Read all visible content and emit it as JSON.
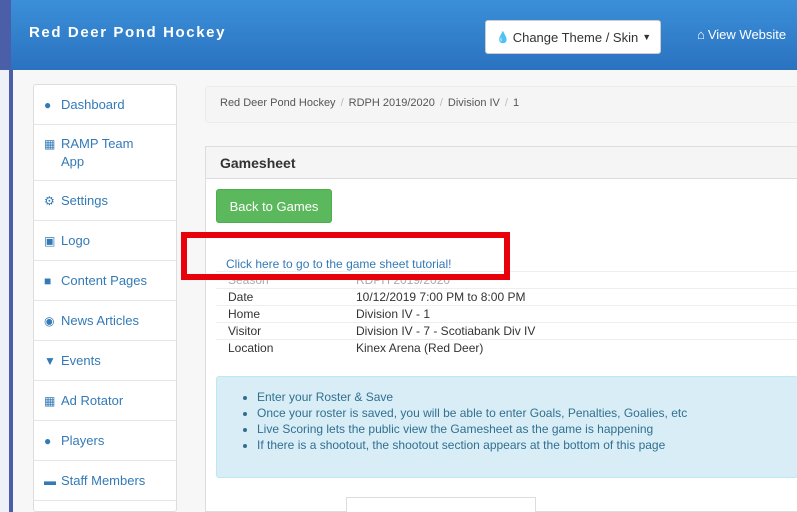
{
  "navbar": {
    "brand": "Red Deer Pond Hockey",
    "theme_button": "Change Theme / Skin",
    "view_website": "View Website"
  },
  "sidebar": {
    "items": [
      {
        "label": "Dashboard",
        "icon": "user-icon"
      },
      {
        "label": "RAMP Team\nApp",
        "icon": "grid-icon"
      },
      {
        "label": "Settings",
        "icon": "gear-icon"
      },
      {
        "label": "Logo",
        "icon": "camera-icon"
      },
      {
        "label": "Content Pages",
        "icon": "file-icon"
      },
      {
        "label": "News Articles",
        "icon": "globe-icon"
      },
      {
        "label": "Events",
        "icon": "glass-icon"
      },
      {
        "label": "Ad Rotator",
        "icon": "users-icon"
      },
      {
        "label": "Players",
        "icon": "user-icon"
      },
      {
        "label": "Staff Members",
        "icon": "briefcase-icon"
      }
    ]
  },
  "breadcrumb": [
    "Red Deer Pond Hockey",
    "RDPH 2019/2020",
    "Division IV",
    "1"
  ],
  "panel": {
    "title": "Gamesheet",
    "back_button": "Back to Games",
    "tutorial_link": "Click here to go to the game sheet tutorial!",
    "info": [
      {
        "k": "Season",
        "v": "RDPH 2019/2020"
      },
      {
        "k": "Date",
        "v": "10/12/2019 7:00 PM to 8:00 PM"
      },
      {
        "k": "Home",
        "v": "Division IV - 1"
      },
      {
        "k": "Visitor",
        "v": "Division IV - 7 - Scotiabank Div IV"
      },
      {
        "k": "Location",
        "v": "Kinex Arena (Red Deer)"
      }
    ],
    "notes": [
      "Enter your Roster & Save",
      "Once your roster is saved, you will be able to enter Goals, Penalties, Goalies, etc",
      "Live Scoring lets the public view the Gamesheet as the game is happening",
      "If there is a shootout, the shootout section appears at the bottom of this page"
    ]
  },
  "colors": {
    "navbar": "#2f7fcc",
    "link": "#337ab7",
    "success": "#5cb85c",
    "highlight": "#e8000b",
    "info_bg": "#d9edf7"
  }
}
